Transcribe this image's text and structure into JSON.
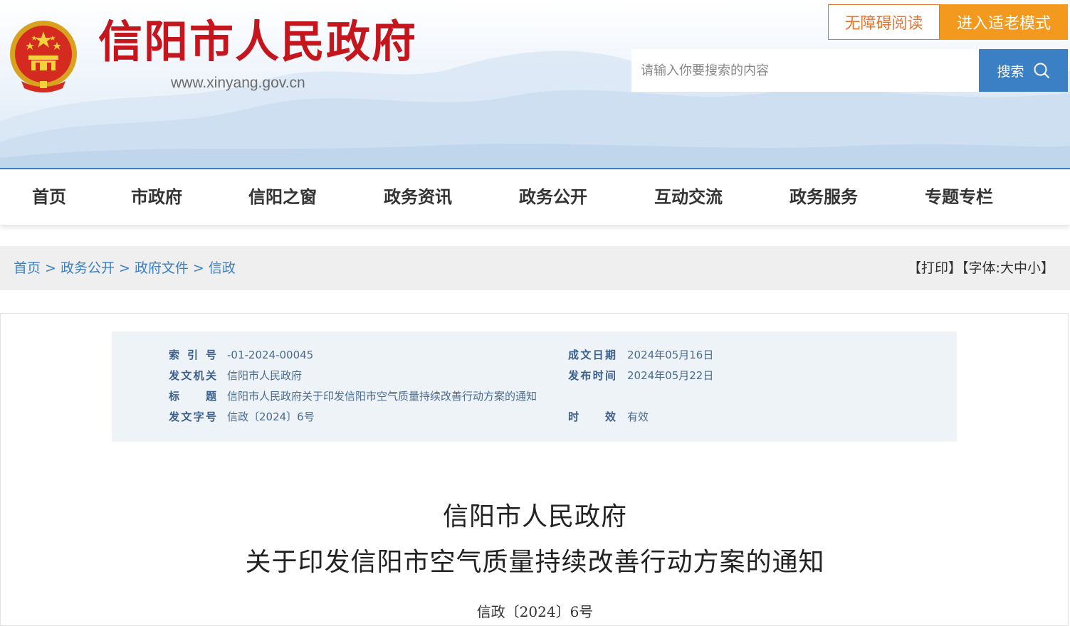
{
  "header": {
    "site_title": "信阳市人民政府",
    "site_url": "www.xinyang.gov.cn",
    "accessibility_label": "无障碍阅读",
    "elder_mode_label": "进入适老模式",
    "search": {
      "placeholder": "请输入你要搜索的内容",
      "button_label": "搜索"
    },
    "colors": {
      "title_red": "#c4161c",
      "accent_blue": "#3b7fc4",
      "orange": "#f39a1e"
    }
  },
  "nav": {
    "items": [
      {
        "label": "首页"
      },
      {
        "label": "市政府"
      },
      {
        "label": "信阳之窗"
      },
      {
        "label": "政务资讯"
      },
      {
        "label": "政务公开"
      },
      {
        "label": "互动交流"
      },
      {
        "label": "政务服务"
      },
      {
        "label": "专题专栏"
      }
    ]
  },
  "breadcrumb": {
    "items": [
      {
        "label": "首页"
      },
      {
        "label": "政务公开"
      },
      {
        "label": "政府文件"
      },
      {
        "label": "信政"
      }
    ],
    "separator": ">"
  },
  "tools": {
    "print": "【打印】",
    "font_prefix": "【字体:",
    "font_large": "大",
    "font_medium": "中",
    "font_small": "小",
    "font_suffix": "】"
  },
  "meta": {
    "index_label": "索 引 号",
    "index_value": "-01-2024-00045",
    "date_written_label": "成文日期",
    "date_written_value": "2024年05月16日",
    "issuer_label": "发文机关",
    "issuer_value": "信阳市人民政府",
    "publish_label": "发布时间",
    "publish_value": "2024年05月22日",
    "title_label": "标 题",
    "title_value": "信阳市人民政府关于印发信阳市空气质量持续改善行动方案的通知",
    "doc_no_label": "发文字号",
    "doc_no_value": "信政〔2024〕6号",
    "validity_label": "时 效",
    "validity_value": "有效"
  },
  "document": {
    "title_line1": "信阳市人民政府",
    "title_line2": "关于印发信阳市空气质量持续改善行动方案的通知",
    "doc_number": "信政〔2024〕6号"
  }
}
